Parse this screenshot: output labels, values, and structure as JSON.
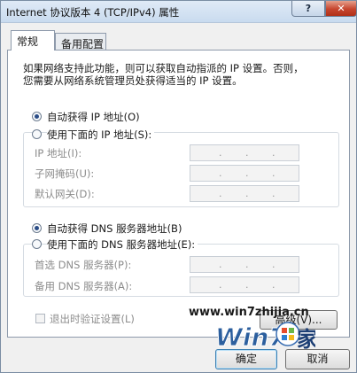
{
  "window": {
    "title": "Internet 协议版本 4 (TCP/IPv4) 属性",
    "help_label": "?",
    "close_label": "✕"
  },
  "tabs": [
    {
      "label": "常规",
      "active": true
    },
    {
      "label": "备用配置",
      "active": false
    }
  ],
  "description": "如果网络支持此功能，则可以获取自动指派的 IP 设置。否则，\n您需要从网络系统管理员处获得适当的 IP 设置。",
  "ip": {
    "auto_label": "自动获得 IP 地址(O)",
    "auto_selected": true,
    "manual_label": "使用下面的 IP 地址(S):",
    "fields": [
      {
        "label": "IP 地址(I):"
      },
      {
        "label": "子网掩码(U):"
      },
      {
        "label": "默认网关(D):"
      }
    ]
  },
  "dns": {
    "auto_label": "自动获得 DNS 服务器地址(B)",
    "auto_selected": true,
    "manual_label": "使用下面的 DNS 服务器地址(E):",
    "fields": [
      {
        "label": "首选 DNS 服务器(P):"
      },
      {
        "label": "备用 DNS 服务器(A):"
      }
    ]
  },
  "validate": {
    "label": "退出时验证设置(L)",
    "checked": false
  },
  "advanced_label": "高级(V)...",
  "ip_dot": ".",
  "buttons": {
    "ok": "确定",
    "cancel": "取消"
  },
  "watermark": {
    "url": "www.win7zhijia.cn",
    "logo_text": "Win7",
    "logo_char": "家"
  }
}
